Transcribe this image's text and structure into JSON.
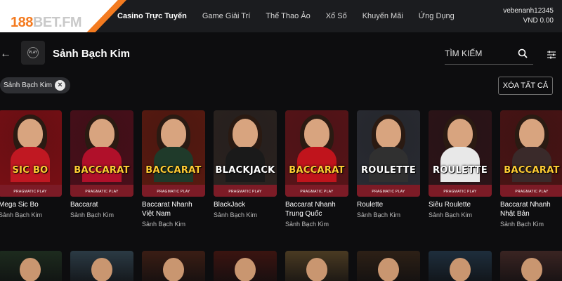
{
  "logo": {
    "prefix": "188",
    "suffix": "BET.FM"
  },
  "nav": {
    "items": [
      "Casino Trực Tuyến",
      "Game Giải Trí",
      "Thể Thao Ảo",
      "Xổ Số",
      "Khuyến Mãi",
      "Ứng Dụng"
    ],
    "active_index": 0
  },
  "account": {
    "username": "vebenanh12345",
    "balance": "VND 0.00"
  },
  "section": {
    "title": "Sảnh Bạch Kim",
    "logo_text": "PLAY"
  },
  "search": {
    "placeholder": "TÌM KIẾM"
  },
  "filter": {
    "chip_label": "Sảnh Bạch Kim",
    "clear_label": "XÓA TẤT CẢ"
  },
  "games": [
    {
      "name": "Mega Sic Bo",
      "provider": "Sảnh Bạch Kim",
      "logo": "SIC BO",
      "bg": "#7a0f14",
      "accent": "#ffcc33",
      "body": "#c01822"
    },
    {
      "name": "Baccarat",
      "provider": "Sảnh Bạch Kim",
      "logo": "BACCARAT",
      "bg": "#4a0f1a",
      "accent": "#ffcc33",
      "body": "#b0102a"
    },
    {
      "name": "Baccarat Nhanh Việt Nam",
      "provider": "Sảnh Bạch Kim",
      "logo": "BACCARAT",
      "bg": "#5a1a10",
      "accent": "#ffcc33",
      "body": "#1f3a2a"
    },
    {
      "name": "BlackJack",
      "provider": "Sảnh Bạch Kim",
      "logo": "BLACKJACK",
      "bg": "#2b2320",
      "accent": "#ffffff",
      "body": "#1a1a1a"
    },
    {
      "name": "Baccarat Nhanh Trung Quốc",
      "provider": "Sảnh Bạch Kim",
      "logo": "BACCARAT",
      "bg": "#5a1418",
      "accent": "#ffcc33",
      "body": "#c0141c"
    },
    {
      "name": "Roulette",
      "provider": "Sảnh Bạch Kim",
      "logo": "ROULETTE",
      "bg": "#2a2c33",
      "accent": "#ffffff",
      "body": "#303030"
    },
    {
      "name": "Siêu Roulette",
      "provider": "Sảnh Bạch Kim",
      "logo": "ROULETTE",
      "bg": "#2d1418",
      "accent": "#ffffff",
      "body": "#e8e8e8"
    },
    {
      "name": "Baccarat Nhanh Nhật Bản",
      "provider": "Sảnh Bạch Kim",
      "logo": "BACCARAT",
      "bg": "#4a1414",
      "accent": "#ffcc33",
      "body": "#3a2a2a"
    }
  ],
  "second_row_colors": [
    "#1d2b1e",
    "#2b3a44",
    "#3a1d14",
    "#3b1410",
    "#4a3a22",
    "#2d2016",
    "#1e2e3c",
    "#3a2422"
  ],
  "pp_label": "PRAGMATIC PLAY"
}
